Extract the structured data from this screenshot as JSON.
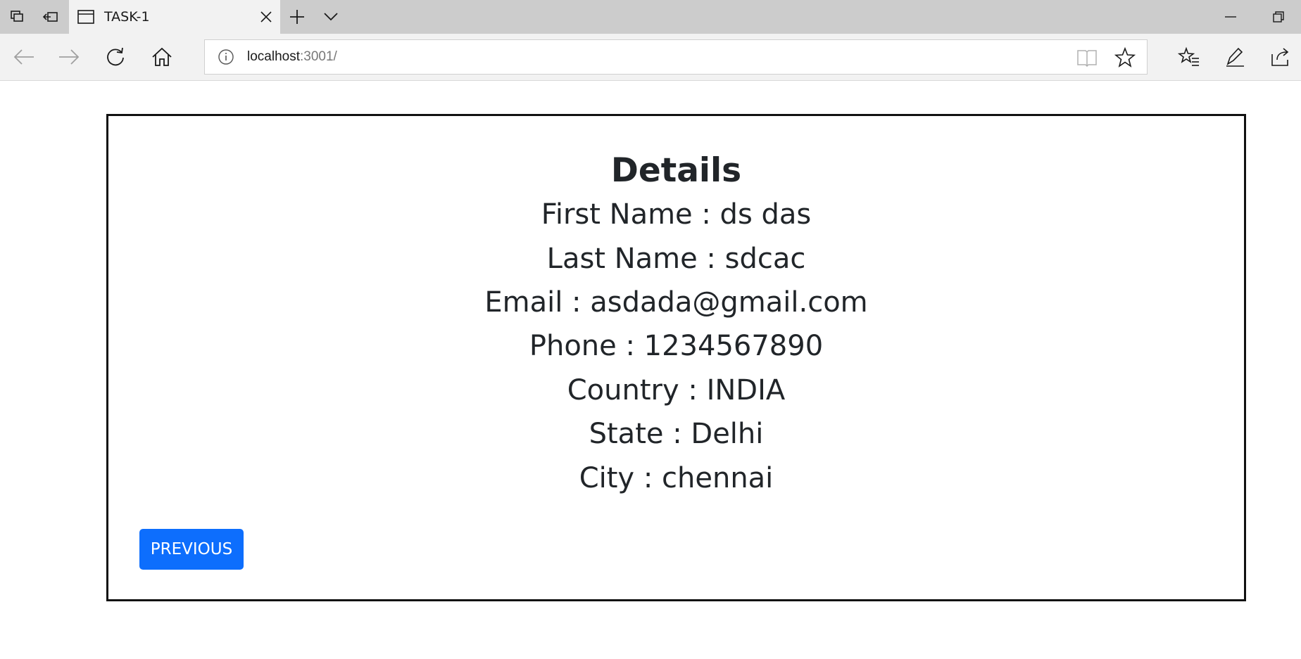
{
  "browser": {
    "tab": {
      "title": "TASK-1"
    },
    "address": {
      "host": "localhost",
      "port_path": ":3001/"
    }
  },
  "page": {
    "heading": "Details",
    "lines": [
      "First Name : ds das",
      "Last Name : sdcac",
      "Email : asdada@gmail.com",
      "Phone : 1234567890",
      "Country : INDIA",
      "State : Delhi",
      "City : chennai"
    ],
    "previous_label": "PREVIOUS",
    "colors": {
      "primary": "#0d6efd",
      "text": "#212529"
    }
  },
  "icons": {
    "tab_actions": "tabs-aside-icon",
    "tab_back": "set-aside-icon",
    "new_tab": "plus-icon",
    "tab_list": "chevron-down-icon",
    "minimize": "minimize-icon",
    "restore": "restore-icon",
    "back": "back-arrow-icon",
    "forward": "forward-arrow-icon",
    "refresh": "refresh-icon",
    "home": "home-icon",
    "info": "info-icon",
    "reader": "reading-view-icon",
    "favorite": "star-icon",
    "favorites_list": "favorites-icon",
    "notes": "pen-icon",
    "share": "share-icon"
  }
}
